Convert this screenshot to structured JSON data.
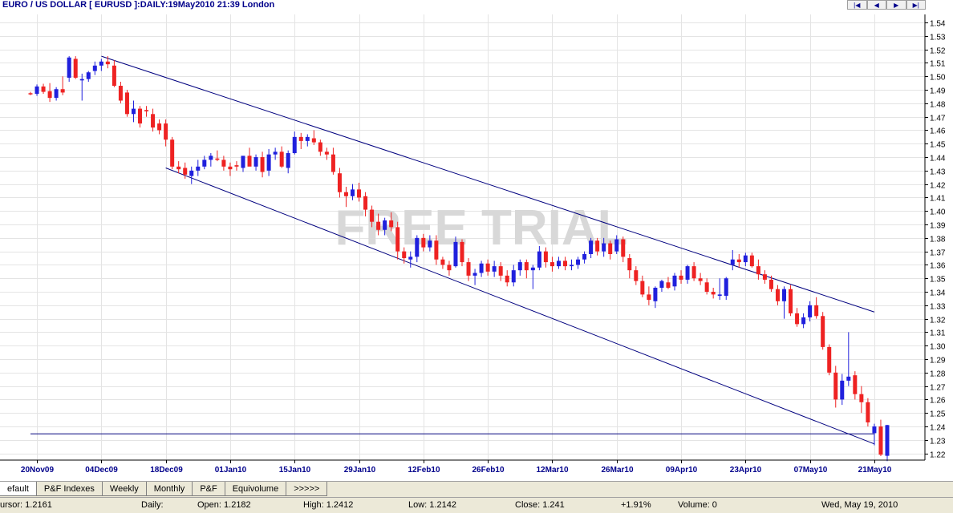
{
  "window": {
    "title": "EURO / US DOLLAR [ EURUSD ]:DAILY:19May2010 21:39 London",
    "nav_buttons": [
      "|◀",
      "◀",
      "▶",
      "▶|"
    ]
  },
  "watermark": "FREE TRIAL",
  "tabs": [
    {
      "label": "efault",
      "active": true
    },
    {
      "label": "P&F Indexes",
      "active": false
    },
    {
      "label": "Weekly",
      "active": false
    },
    {
      "label": "Monthly",
      "active": false
    },
    {
      "label": "P&F",
      "active": false
    },
    {
      "label": "Equivolume",
      "active": false
    },
    {
      "label": ">>>>>",
      "active": false
    }
  ],
  "status": {
    "cursor": "ursor: 1.2161",
    "period": "Daily:",
    "open": "Open: 1.2182",
    "high": "High: 1.2412",
    "low": "Low: 1.2142",
    "close": "Close: 1.241",
    "change": "+1.91%",
    "volume": "Volume: 0",
    "date": "Wed, May 19, 2010"
  },
  "chart_data": {
    "type": "candlestick",
    "y_ticks": [
      "1.54",
      "1.53",
      "1.52",
      "1.51",
      "1.50",
      "1.49",
      "1.48",
      "1.47",
      "1.46",
      "1.45",
      "1.44",
      "1.43",
      "1.42",
      "1.41",
      "1.40",
      "1.39",
      "1.38",
      "1.37",
      "1.36",
      "1.35",
      "1.34",
      "1.33",
      "1.32",
      "1.31",
      "1.30",
      "1.29",
      "1.28",
      "1.27",
      "1.26",
      "1.25",
      "1.24",
      "1.23",
      "1.22"
    ],
    "x_ticks": [
      {
        "label": "20Nov09",
        "index": 1
      },
      {
        "label": "04Dec09",
        "index": 11
      },
      {
        "label": "18Dec09",
        "index": 21
      },
      {
        "label": "01Jan10",
        "index": 31
      },
      {
        "label": "15Jan10",
        "index": 41
      },
      {
        "label": "29Jan10",
        "index": 51
      },
      {
        "label": "12Feb10",
        "index": 61
      },
      {
        "label": "26Feb10",
        "index": 71
      },
      {
        "label": "12Mar10",
        "index": 81
      },
      {
        "label": "26Mar10",
        "index": 91
      },
      {
        "label": "09Apr10",
        "index": 101
      },
      {
        "label": "23Apr10",
        "index": 111
      },
      {
        "label": "07May10",
        "index": 121
      },
      {
        "label": "21May10",
        "index": 131
      }
    ],
    "ylim": [
      1.215,
      1.546
    ],
    "index_range": [
      0,
      132
    ],
    "up_color": "#2020dd",
    "down_color": "#ee2222",
    "line_color": "#00007f",
    "candles": [
      [
        1.4875,
        1.4885,
        1.486,
        1.487
      ],
      [
        1.487,
        1.494,
        1.4855,
        1.4925
      ],
      [
        1.4925,
        1.4945,
        1.487,
        1.4885
      ],
      [
        1.489,
        1.495,
        1.481,
        1.484
      ],
      [
        1.484,
        1.492,
        1.482,
        1.4905
      ],
      [
        1.4905,
        1.5,
        1.486,
        1.488
      ],
      [
        1.499,
        1.515,
        1.496,
        1.514
      ],
      [
        1.513,
        1.515,
        1.498,
        1.499
      ],
      [
        1.497,
        1.502,
        1.482,
        1.498
      ],
      [
        1.498,
        1.504,
        1.496,
        1.503
      ],
      [
        1.504,
        1.511,
        1.501,
        1.508
      ],
      [
        1.508,
        1.513,
        1.504,
        1.511
      ],
      [
        1.511,
        1.515,
        1.506,
        1.509
      ],
      [
        1.508,
        1.512,
        1.492,
        1.493
      ],
      [
        1.493,
        1.496,
        1.48,
        1.482
      ],
      [
        1.488,
        1.49,
        1.47,
        1.472
      ],
      [
        1.472,
        1.482,
        1.466,
        1.476
      ],
      [
        1.476,
        1.478,
        1.462,
        1.465
      ],
      [
        1.475,
        1.478,
        1.47,
        1.474
      ],
      [
        1.472,
        1.476,
        1.459,
        1.462
      ],
      [
        1.465,
        1.468,
        1.457,
        1.46
      ],
      [
        1.465,
        1.468,
        1.448,
        1.453
      ],
      [
        1.453,
        1.455,
        1.431,
        1.433
      ],
      [
        1.433,
        1.437,
        1.428,
        1.431
      ],
      [
        1.432,
        1.436,
        1.424,
        1.427
      ],
      [
        1.426,
        1.433,
        1.42,
        1.43
      ],
      [
        1.43,
        1.438,
        1.426,
        1.433
      ],
      [
        1.433,
        1.441,
        1.431,
        1.438
      ],
      [
        1.438,
        1.443,
        1.433,
        1.441
      ],
      [
        1.439,
        1.445,
        1.437,
        1.438
      ],
      [
        1.438,
        1.441,
        1.43,
        1.433
      ],
      [
        1.433,
        1.436,
        1.426,
        1.431
      ],
      [
        1.434,
        1.437,
        1.43,
        1.433
      ],
      [
        1.432,
        1.44,
        1.429,
        1.441
      ],
      [
        1.441,
        1.447,
        1.435,
        1.433
      ],
      [
        1.433,
        1.442,
        1.43,
        1.44
      ],
      [
        1.44,
        1.444,
        1.425,
        1.429
      ],
      [
        1.43,
        1.446,
        1.426,
        1.442
      ],
      [
        1.442,
        1.447,
        1.438,
        1.444
      ],
      [
        1.444,
        1.448,
        1.432,
        1.433
      ],
      [
        1.432,
        1.445,
        1.428,
        1.443
      ],
      [
        1.443,
        1.459,
        1.442,
        1.455
      ],
      [
        1.455,
        1.458,
        1.446,
        1.452
      ],
      [
        1.452,
        1.457,
        1.448,
        1.455
      ],
      [
        1.454,
        1.46,
        1.449,
        1.451
      ],
      [
        1.451,
        1.453,
        1.441,
        1.444
      ],
      [
        1.444,
        1.447,
        1.438,
        1.442
      ],
      [
        1.442,
        1.447,
        1.427,
        1.429
      ],
      [
        1.428,
        1.432,
        1.41,
        1.414
      ],
      [
        1.414,
        1.418,
        1.403,
        1.411
      ],
      [
        1.411,
        1.42,
        1.408,
        1.416
      ],
      [
        1.416,
        1.421,
        1.407,
        1.41
      ],
      [
        1.411,
        1.414,
        1.396,
        1.401
      ],
      [
        1.401,
        1.404,
        1.388,
        1.392
      ],
      [
        1.392,
        1.398,
        1.382,
        1.386
      ],
      [
        1.386,
        1.395,
        1.382,
        1.393
      ],
      [
        1.393,
        1.399,
        1.385,
        1.388
      ],
      [
        1.388,
        1.392,
        1.364,
        1.37
      ],
      [
        1.37,
        1.373,
        1.361,
        1.365
      ],
      [
        1.364,
        1.37,
        1.358,
        1.366
      ],
      [
        1.366,
        1.382,
        1.362,
        1.38
      ],
      [
        1.38,
        1.383,
        1.37,
        1.373
      ],
      [
        1.373,
        1.382,
        1.37,
        1.378
      ],
      [
        1.378,
        1.382,
        1.36,
        1.364
      ],
      [
        1.364,
        1.366,
        1.357,
        1.36
      ],
      [
        1.36,
        1.363,
        1.352,
        1.356
      ],
      [
        1.359,
        1.381,
        1.358,
        1.377
      ],
      [
        1.377,
        1.379,
        1.359,
        1.362
      ],
      [
        1.362,
        1.365,
        1.348,
        1.352
      ],
      [
        1.352,
        1.357,
        1.345,
        1.354
      ],
      [
        1.354,
        1.363,
        1.351,
        1.361
      ],
      [
        1.361,
        1.364,
        1.352,
        1.355
      ],
      [
        1.355,
        1.363,
        1.351,
        1.359
      ],
      [
        1.359,
        1.362,
        1.348,
        1.352
      ],
      [
        1.352,
        1.356,
        1.344,
        1.347
      ],
      [
        1.347,
        1.36,
        1.344,
        1.356
      ],
      [
        1.356,
        1.364,
        1.352,
        1.362
      ],
      [
        1.362,
        1.364,
        1.35,
        1.356
      ],
      [
        1.356,
        1.36,
        1.342,
        1.358
      ],
      [
        1.358,
        1.374,
        1.356,
        1.37
      ],
      [
        1.37,
        1.373,
        1.358,
        1.362
      ],
      [
        1.362,
        1.366,
        1.355,
        1.359
      ],
      [
        1.359,
        1.366,
        1.357,
        1.363
      ],
      [
        1.363,
        1.366,
        1.356,
        1.359
      ],
      [
        1.359,
        1.364,
        1.356,
        1.36
      ],
      [
        1.36,
        1.366,
        1.357,
        1.364
      ],
      [
        1.364,
        1.37,
        1.361,
        1.368
      ],
      [
        1.368,
        1.38,
        1.365,
        1.378
      ],
      [
        1.378,
        1.38,
        1.367,
        1.37
      ],
      [
        1.37,
        1.38,
        1.366,
        1.376
      ],
      [
        1.376,
        1.378,
        1.364,
        1.368
      ],
      [
        1.37,
        1.382,
        1.368,
        1.379
      ],
      [
        1.379,
        1.381,
        1.362,
        1.366
      ],
      [
        1.365,
        1.368,
        1.35,
        1.356
      ],
      [
        1.356,
        1.359,
        1.345,
        1.348
      ],
      [
        1.348,
        1.352,
        1.336,
        1.338
      ],
      [
        1.338,
        1.344,
        1.33,
        1.334
      ],
      [
        1.333,
        1.344,
        1.328,
        1.343
      ],
      [
        1.343,
        1.349,
        1.34,
        1.348
      ],
      [
        1.347,
        1.351,
        1.342,
        1.343
      ],
      [
        1.344,
        1.354,
        1.341,
        1.352
      ],
      [
        1.352,
        1.356,
        1.346,
        1.349
      ],
      [
        1.349,
        1.36,
        1.346,
        1.359
      ],
      [
        1.359,
        1.362,
        1.348,
        1.35
      ],
      [
        1.35,
        1.354,
        1.345,
        1.348
      ],
      [
        1.347,
        1.35,
        1.338,
        1.34
      ],
      [
        1.34,
        1.343,
        1.335,
        1.338
      ],
      [
        1.337,
        1.35,
        1.334,
        1.338
      ],
      [
        1.337,
        1.351,
        1.334,
        1.35
      ],
      [
        1.36,
        1.371,
        1.356,
        1.364
      ],
      [
        1.364,
        1.368,
        1.358,
        1.362
      ],
      [
        1.362,
        1.369,
        1.359,
        1.367
      ],
      [
        1.367,
        1.369,
        1.358,
        1.359
      ],
      [
        1.359,
        1.364,
        1.349,
        1.353
      ],
      [
        1.353,
        1.356,
        1.346,
        1.349
      ],
      [
        1.349,
        1.352,
        1.34,
        1.342
      ],
      [
        1.342,
        1.345,
        1.33,
        1.333
      ],
      [
        1.333,
        1.344,
        1.32,
        1.342
      ],
      [
        1.342,
        1.345,
        1.322,
        1.324
      ],
      [
        1.324,
        1.328,
        1.314,
        1.316
      ],
      [
        1.316,
        1.324,
        1.313,
        1.321
      ],
      [
        1.321,
        1.333,
        1.318,
        1.33
      ],
      [
        1.33,
        1.336,
        1.32,
        1.322
      ],
      [
        1.322,
        1.325,
        1.297,
        1.299
      ],
      [
        1.299,
        1.301,
        1.278,
        1.28
      ],
      [
        1.28,
        1.285,
        1.254,
        1.26
      ],
      [
        1.26,
        1.279,
        1.256,
        1.274
      ],
      [
        1.274,
        1.31,
        1.27,
        1.277
      ],
      [
        1.278,
        1.281,
        1.26,
        1.264
      ],
      [
        1.264,
        1.27,
        1.25,
        1.258
      ],
      [
        1.258,
        1.261,
        1.24,
        1.243
      ],
      [
        1.235,
        1.242,
        1.226,
        1.24
      ],
      [
        1.24,
        1.245,
        1.218,
        1.219
      ],
      [
        1.2182,
        1.2412,
        1.2142,
        1.241
      ]
    ],
    "trendlines": [
      [
        11,
        1.515,
        131,
        1.325
      ],
      [
        21,
        1.432,
        131,
        1.227
      ],
      [
        0,
        1.2345,
        131,
        1.2345
      ]
    ]
  }
}
